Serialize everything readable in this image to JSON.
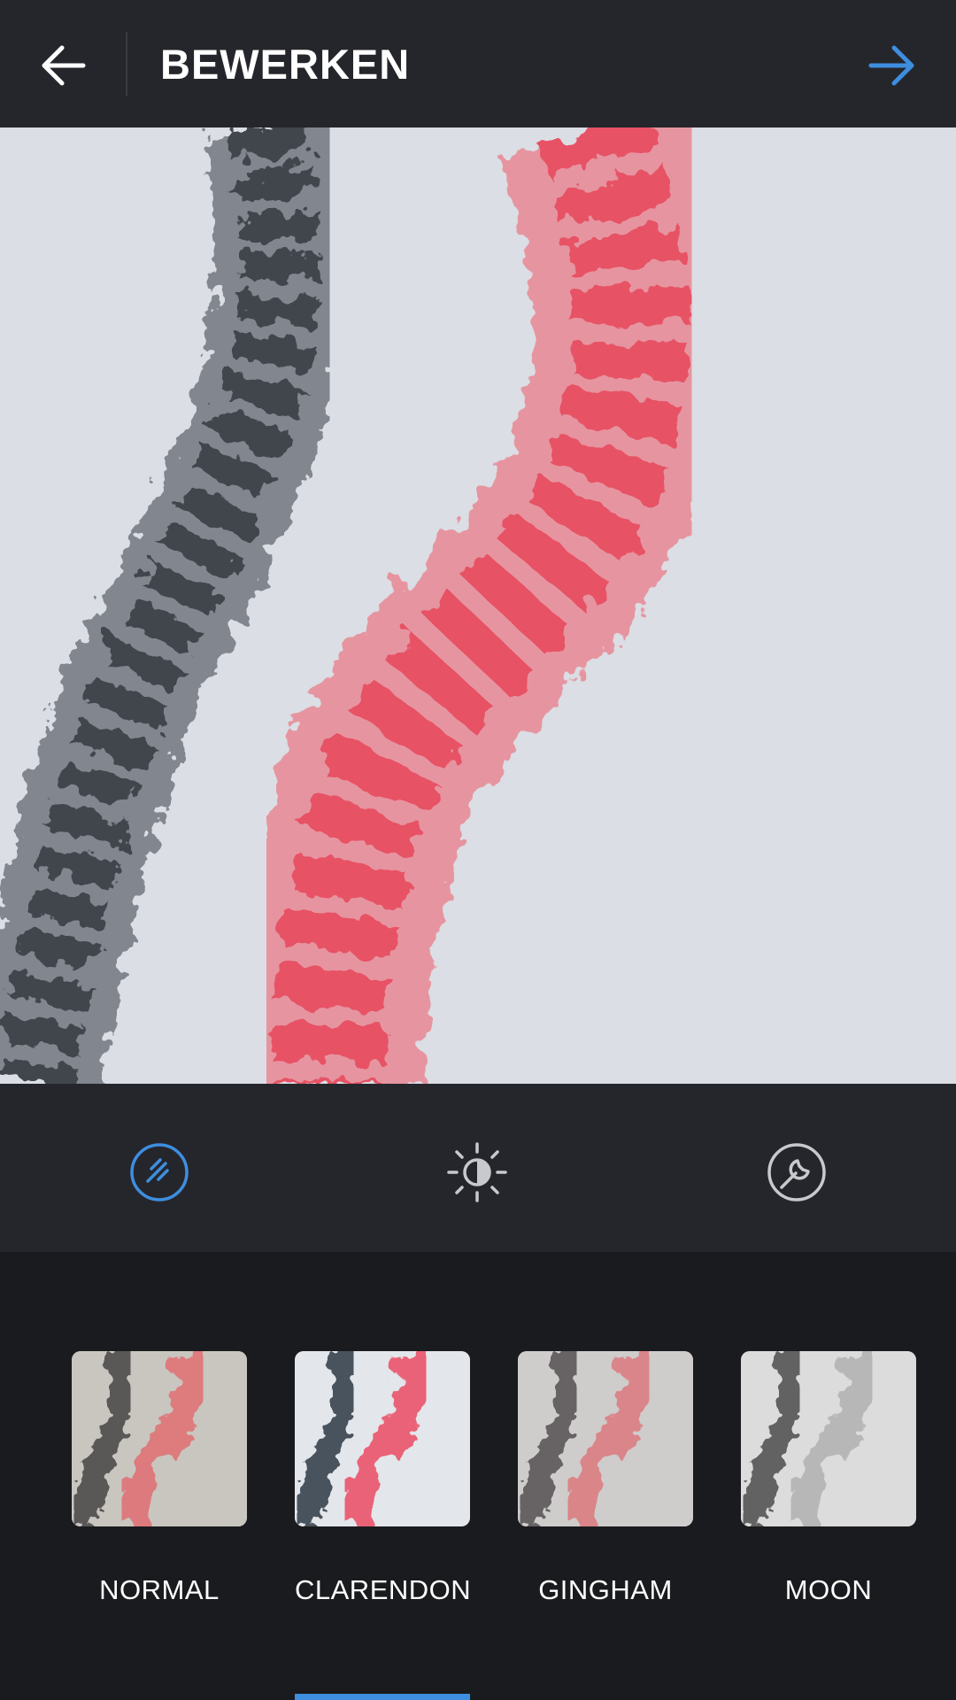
{
  "header": {
    "title": "BEWERKEN",
    "back_icon": "arrow-left-icon",
    "next_icon": "arrow-right-icon",
    "next_color": "#3e8ee0"
  },
  "toolbar": {
    "active_tool": "filter",
    "tools": [
      {
        "icon": "filter-icon",
        "active": true
      },
      {
        "icon": "brightness-icon",
        "active": false
      },
      {
        "icon": "wrench-icon",
        "active": false
      }
    ],
    "accent_color": "#3e8ee0"
  },
  "filters": {
    "selected": "CLARENDON",
    "items": [
      {
        "label": "NORMAL"
      },
      {
        "label": "CLARENDON"
      },
      {
        "label": "GINGHAM"
      },
      {
        "label": "MOON"
      }
    ]
  }
}
